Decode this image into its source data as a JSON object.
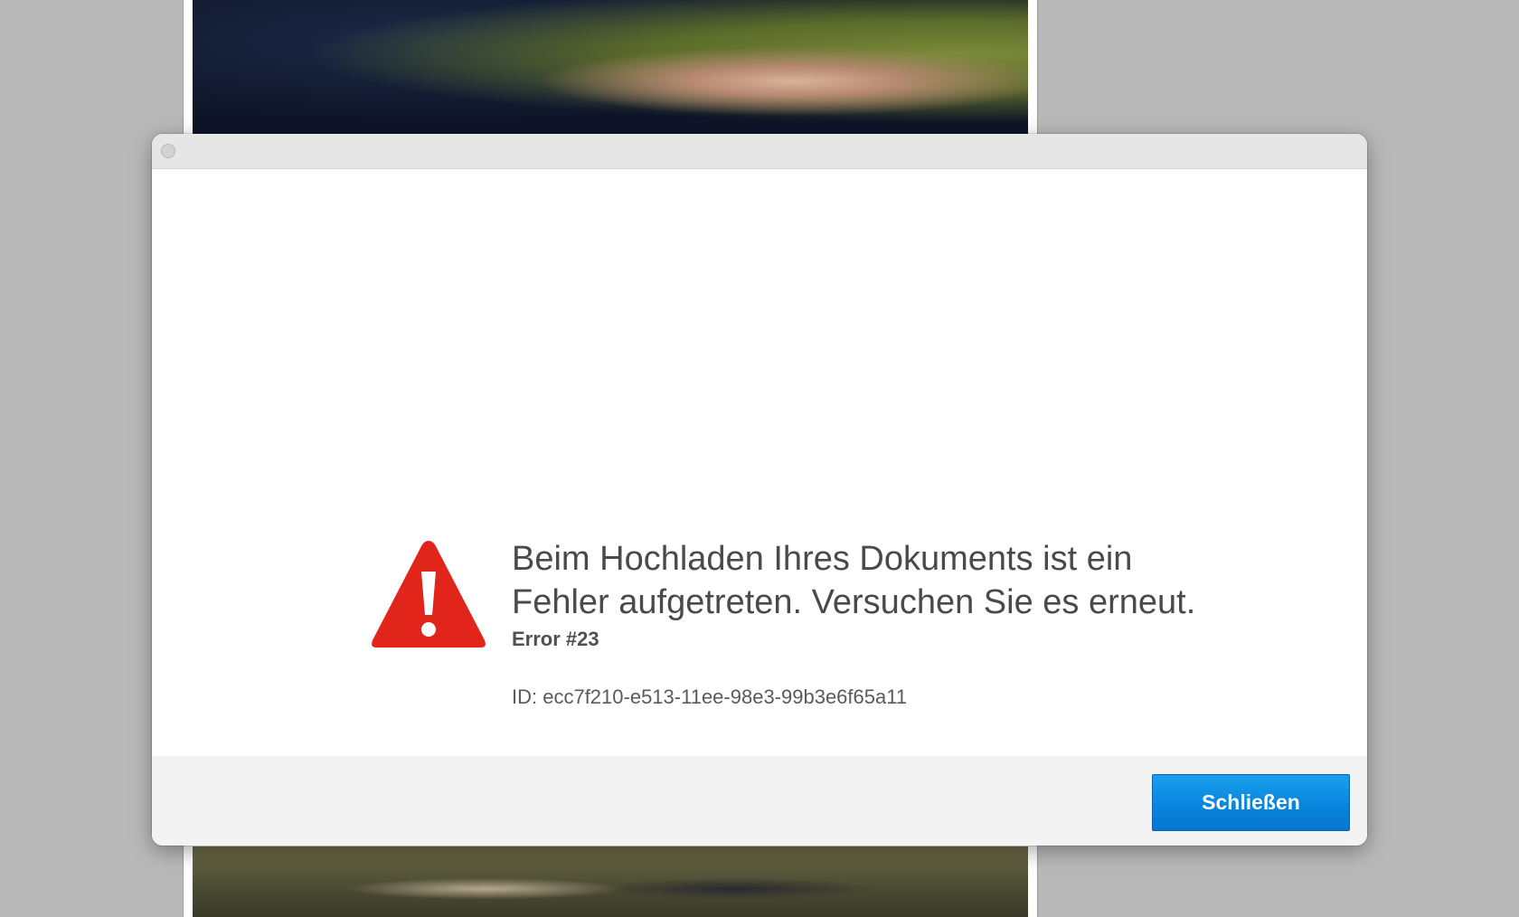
{
  "dialog": {
    "title_text": "",
    "headline": "Beim Hochladen Ihres Dokuments ist ein Fehler aufgetreten. Versuchen Sie es erneut.",
    "error_code": "Error #23",
    "error_id": "ID: ecc7f210-e513-11ee-98e3-99b3e6f65a11",
    "close_button_label": "Schließen",
    "icon": "warning-triangle-icon"
  },
  "colors": {
    "warning_red": "#e1251b",
    "button_blue": "#0985de",
    "background_gray": "#b9b9b9"
  }
}
